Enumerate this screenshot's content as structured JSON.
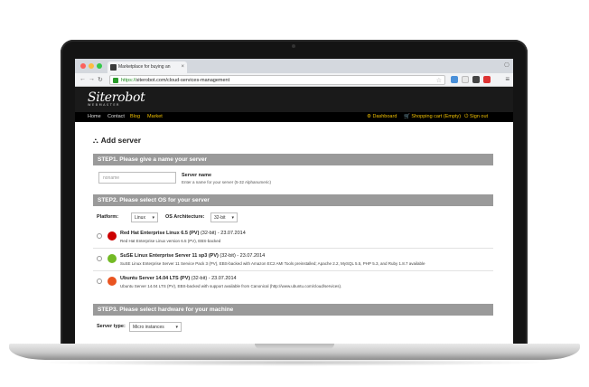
{
  "browser": {
    "tab_title": "Marketplace for buying an",
    "url_scheme": "https://",
    "url_rest": "siterobot.com/cloud-services-management"
  },
  "site": {
    "logo": "Siterobot",
    "logo_sub": "WEBMASTER",
    "nav": [
      "Home",
      "Contact",
      "Blog",
      "Market"
    ],
    "nav_right": {
      "dashboard": "Dashboard",
      "cart": "Shopping cart (Empty)",
      "signout": "Sign out"
    }
  },
  "page": {
    "title": "Add server",
    "step1": {
      "header": "STEP1. Please give a name your server",
      "input_placeholder": "noname",
      "label": "Server name",
      "help": "Enter a name for your server (5-32 Alphanumeric)"
    },
    "step2": {
      "header": "STEP2. Please select OS for your server",
      "platform_label": "Platform:",
      "platform_value": "Linux",
      "arch_label": "OS Architecture:",
      "arch_value": "32-bit",
      "os_list": [
        {
          "name": "Red Hat Enterprise Linux 6.5 (PV)",
          "meta": "(32-bit) - 23.07.2014",
          "desc": "Red Hat Enterprise Linux version 6.5 (PV), EBS-backed",
          "color": "#cc0000"
        },
        {
          "name": "SuSE Linux Enterprise Server 11 sp3 (PV)",
          "meta": "(32-bit) - 23.07.2014",
          "desc": "SuSE Linux Enterprise Server 11 Service Pack 3 (PV), EBS-backed with Amazon EC2 AMI Tools preinstalled; Apache 2.2, MySQL 5.5, PHP 5.3, and Ruby 1.8.7 available",
          "color": "#73ba25"
        },
        {
          "name": "Ubuntu Server 14.04 LTS (PV)",
          "meta": "(32-bit) - 23.07.2014",
          "desc": "Ubuntu Server 14.04 LTS (PV), EBS-backed with support available from Canonical (http://www.ubuntu.com/cloud/services).",
          "color": "#e95420"
        }
      ]
    },
    "step3": {
      "header": "STEP3. Please select hardware for your machine",
      "server_type_label": "Server type:",
      "server_type_value": "Micro instances"
    }
  },
  "colors": {
    "section_header": "#9a9a9a",
    "nav_accent": "#f0c000",
    "header_bg": "#1a1a1a"
  }
}
